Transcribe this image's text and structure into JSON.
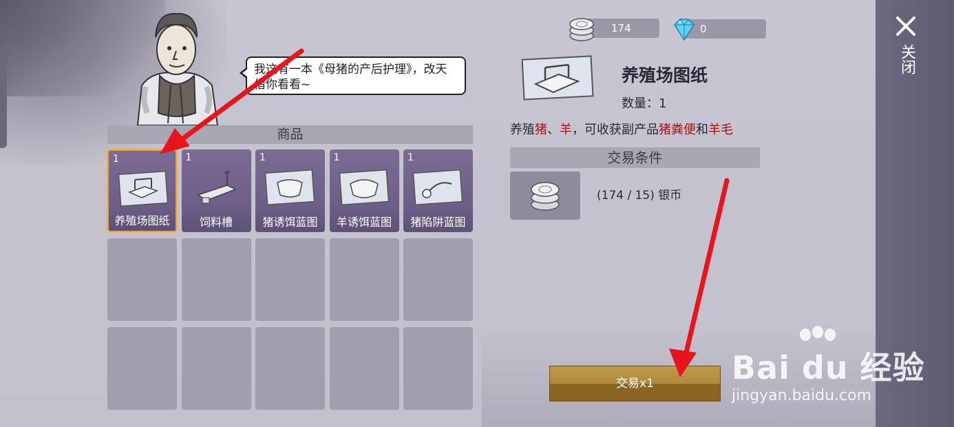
{
  "npc": {
    "dialog": "我这有一本《母猪的产后护理》，改天借你看看~"
  },
  "shop": {
    "header": "商品",
    "items": [
      {
        "qty": "1",
        "name": "养殖场图纸",
        "icon": "blueprint-icon"
      },
      {
        "qty": "1",
        "name": "饲料槽",
        "icon": "feed-trough-icon"
      },
      {
        "qty": "1",
        "name": "猪诱饵蓝图",
        "icon": "blueprint-icon"
      },
      {
        "qty": "1",
        "name": "羊诱饵蓝图",
        "icon": "blueprint-icon"
      },
      {
        "qty": "1",
        "name": "猪陷阱蓝图",
        "icon": "blueprint-icon"
      }
    ]
  },
  "currency": {
    "silver": "174",
    "gems": "0"
  },
  "detail": {
    "title": "养殖场图纸",
    "quantity": "数量：1",
    "desc_parts": [
      "养殖",
      "猪",
      "、",
      "羊",
      "，可收获副产品",
      "猪粪便",
      "和",
      "羊毛"
    ],
    "conditions_header": "交易条件",
    "condition_text": "(174 / 15) 银币",
    "trade_button": "交易x1"
  },
  "side": {
    "close_label": "关闭"
  },
  "watermark": {
    "brand": "Bai du 经验",
    "url": "jingyan.baidu.com"
  },
  "colors": {
    "accent_red": "#a3121b",
    "selected_border": "#f1a21f",
    "item_bg": "#6c5e86",
    "trade_button": "#b08a3a"
  }
}
